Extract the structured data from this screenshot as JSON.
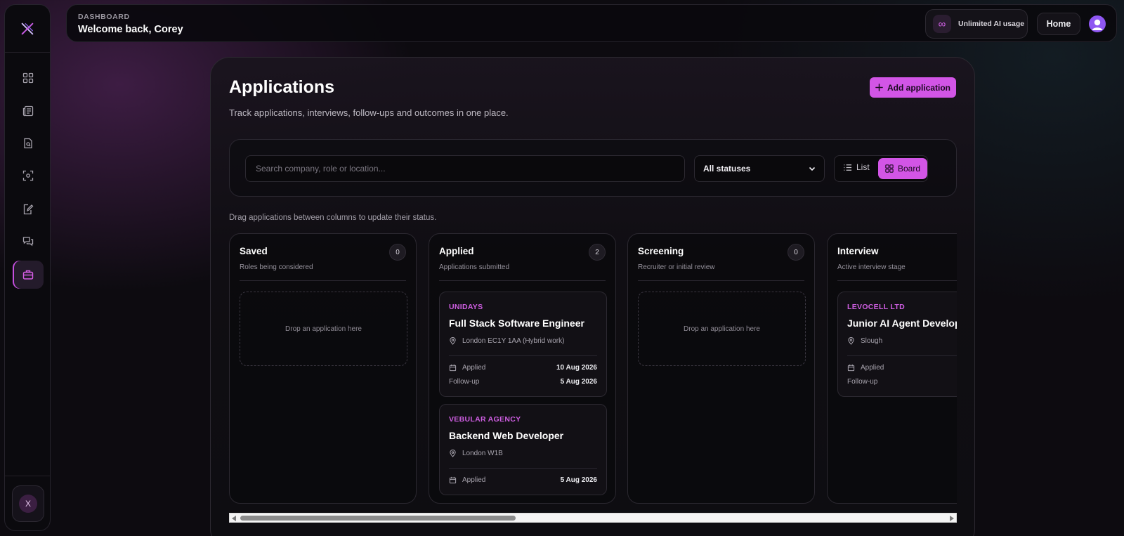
{
  "header": {
    "crumb": "DASHBOARD",
    "welcome": "Welcome back, Corey",
    "ai_usage_label": "Unlimited AI usage",
    "ai_usage_icon": "infinity-icon",
    "home_label": "Home"
  },
  "sidebar": {
    "items": [
      {
        "icon": "dashboard-grid-icon"
      },
      {
        "icon": "newspaper-icon"
      },
      {
        "icon": "document-search-icon"
      },
      {
        "icon": "scan-icon"
      },
      {
        "icon": "edit-document-icon"
      },
      {
        "icon": "chat-icon"
      },
      {
        "icon": "briefcase-icon",
        "active": true
      }
    ],
    "user_initial": "X"
  },
  "page": {
    "title": "Applications",
    "subtitle": "Track applications, interviews, follow-ups and outcomes in one place.",
    "add_label": "Add application",
    "search_placeholder": "Search company, role or location...",
    "status_filter": "All statuses",
    "view_list": "List",
    "view_board": "Board",
    "hint": "Drag applications between columns to update their status."
  },
  "board": {
    "drop_text": "Drop an application here",
    "columns": [
      {
        "title": "Saved",
        "subtitle": "Roles being considered",
        "count": "0"
      },
      {
        "title": "Applied",
        "subtitle": "Applications submitted",
        "count": "2"
      },
      {
        "title": "Screening",
        "subtitle": "Recruiter or initial review",
        "count": "0"
      },
      {
        "title": "Interview",
        "subtitle": "Active interview stage",
        "count": ""
      }
    ],
    "cards": [
      {
        "company": "UNIDAYS",
        "role": "Full Stack Software Engineer",
        "location": "London EC1Y 1AA (Hybrid work)",
        "applied_label": "Applied",
        "applied_date": "10 Aug 2026",
        "followup_label": "Follow-up",
        "followup_date": "5 Aug 2026"
      },
      {
        "company": "VEBULAR AGENCY",
        "role": "Backend Web Developer",
        "location": "London W1B",
        "applied_label": "Applied",
        "applied_date": "5 Aug 2026"
      },
      {
        "company": "LEVOCELL LTD",
        "role": "Junior AI Agent Developer",
        "location": "Slough",
        "applied_label": "Applied",
        "followup_label": "Follow-up"
      }
    ]
  },
  "colors": {
    "accent": "#d255e6",
    "background": "#0d0b10"
  }
}
